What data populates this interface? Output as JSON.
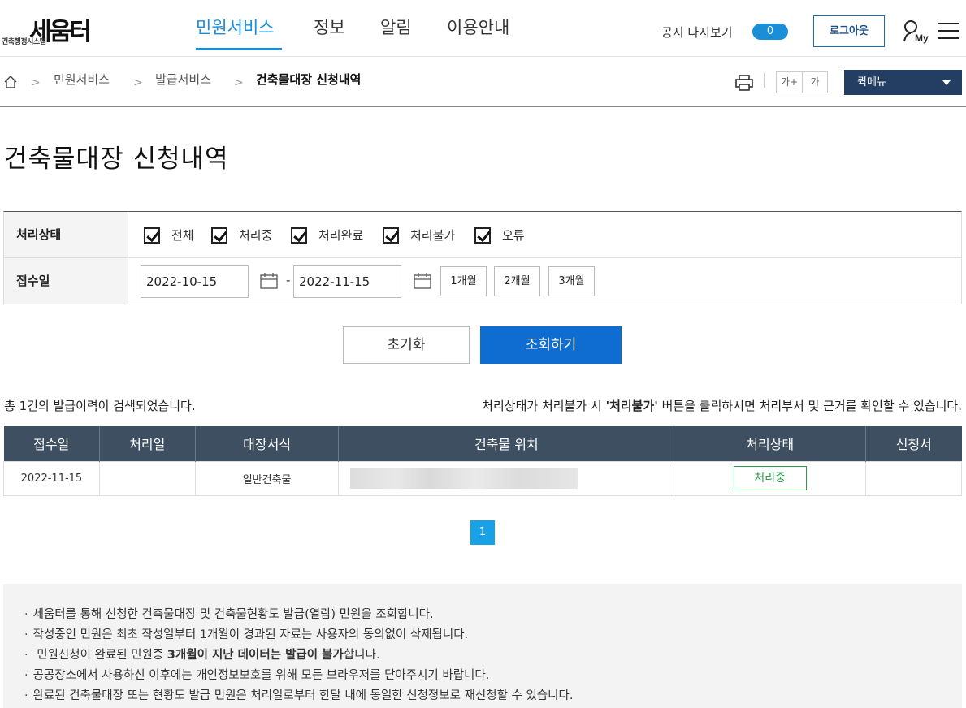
{
  "header": {
    "logo_text": "세움터",
    "logo_sub": "건축행정시스템",
    "menu": [
      "민원서비스",
      "정보",
      "알림",
      "이용안내"
    ],
    "notice_label": "공지 다시보기",
    "notice_count": "0",
    "logout_label": "로그아웃",
    "my_label": "My"
  },
  "breadcrumb": {
    "items": [
      "민원서비스",
      "발급서비스",
      "건축물대장 신청내역"
    ],
    "font_up": "가+",
    "font_down": "가",
    "quick_menu": "퀵메뉴"
  },
  "page_title": "건축물대장 신청내역",
  "filter": {
    "status_label": "처리상태",
    "statuses": [
      "전체",
      "처리중",
      "처리완료",
      "처리불가",
      "오류"
    ],
    "date_label": "접수일",
    "date_from": "2022-10-15",
    "date_to": "2022-11-15",
    "date_sep": "-",
    "periods": [
      "1개월",
      "2개월",
      "3개월"
    ]
  },
  "actions": {
    "reset": "초기화",
    "search": "조회하기"
  },
  "result": {
    "count_text": "총 1건의 발급이력이 검색되었습니다.",
    "help_prefix": "처리상태가 처리불가 시 ",
    "help_bold": "'처리불가'",
    "help_suffix": " 버튼을 클릭하시면 처리부서 및 근거를 확인할 수 있습니다."
  },
  "table": {
    "headers": [
      "접수일",
      "처리일",
      "대장서식",
      "건축물 위치",
      "처리상태",
      "신청서"
    ],
    "rows": [
      {
        "received": "2022-11-15",
        "processed": "",
        "form": "일반건축물",
        "location": "",
        "status": "처리중",
        "application": ""
      }
    ]
  },
  "pagination": {
    "current": "1"
  },
  "notes": {
    "n1": "세움터를 통해 신청한 건축물대장 및 건축물현황도 발급(열람) 민원을 조회합니다.",
    "n2": "작성중인 민원은 최초 작성일부터 1개월이 경과된 자료는 사용자의 동의없이 삭제됩니다.",
    "n3_prefix": " 민원신청이 완료된 민원중 ",
    "n3_bold": "3개월이 지난 데이터는 발급이 불가",
    "n3_suffix": "합니다.",
    "n4": "공공장소에서 사용하신 이후에는 개인정보보호를 위해 모든 브라우저를 닫아주시기 바랍니다.",
    "n5": "완료된 건축물대장 또는 현황도 발급 민원은 처리일로부터 한달 내에 동일한 신청정보로 재신청할 수 있습니다."
  },
  "colors": {
    "primary": "#1a8fd8",
    "search_button": "#0f6dd1",
    "table_header": "#3f4f62",
    "status_green": "#2e9a4b",
    "quick_menu": "#243e63"
  }
}
